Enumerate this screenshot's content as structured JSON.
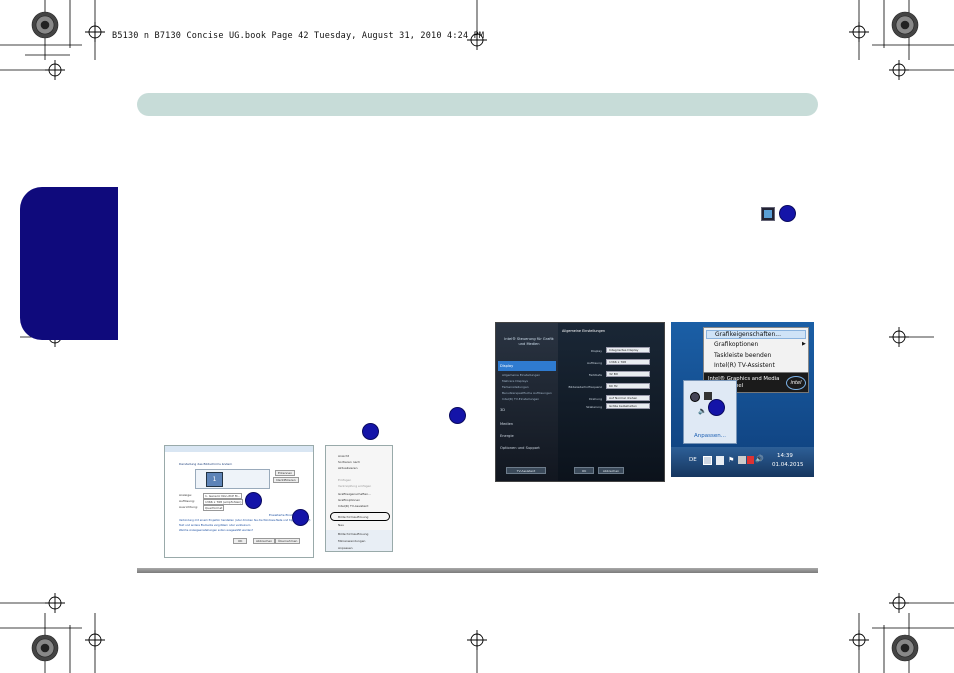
{
  "page_header": {
    "file_info": "B5130 n B7130 Concise UG.book  Page 42  Tuesday, August 31, 2010  4:24 PM"
  },
  "colors": {
    "header_band": "#c7dcd8",
    "side_tab": "#0f0a7c",
    "callout": "#1414a8"
  },
  "dark_panel": {
    "title": "Intel® Steuerung für Grafik und Medien",
    "nav": [
      "Display",
      "3D",
      "Medien",
      "Energie",
      "Optionen und Support"
    ],
    "sub_items": [
      "Allgemeine Einstellungen",
      "Mehrere Displays",
      "Farbeinstellungen",
      "Benutzerspezifische Auflösungen",
      "Intel(R) TV-Einstellungen"
    ],
    "header": "Allgemeine Einstellungen",
    "rows": [
      {
        "label": "Display",
        "value": "Integriertes Display"
      },
      {
        "label": "Auflösung",
        "value": "1366 x 768"
      },
      {
        "label": "Farbtiefe",
        "value": "32 Bit"
      },
      {
        "label": "Bildwiederholfrequenz",
        "value": "60 Hz"
      },
      {
        "label": "Drehung",
        "value": "Auf Normal drehen"
      },
      {
        "label": "Skalierung",
        "value": "Größe beibehalten"
      }
    ],
    "buttons": {
      "tv": "TV-Assistent",
      "ok": "OK",
      "cancel": "Abbrechen"
    }
  },
  "tray_menu": {
    "items": [
      "Grafikeigenschaften...",
      "Grafikoptionen",
      "Taskleiste beenden",
      "Intel(R) TV-Assistent"
    ],
    "banner": "Intel® Graphics and Media Control Panel",
    "intel_logo": "intel",
    "customize": "Anpassen...",
    "lang": "DE",
    "time": "14:39",
    "date": "01.04.2015"
  },
  "win_shot": {
    "heading": "Darstellung des Bildschirms ändern",
    "detect": "Erkennen",
    "identify": "Identifizieren",
    "fields": [
      {
        "label": "Anzeige:",
        "value": "1. Generic Non-PnP M..."
      },
      {
        "label": "Auflösung:",
        "value": "1366 x 768 (empfohlen)"
      },
      {
        "label": "Ausrichtung:",
        "value": "Querformat"
      }
    ],
    "advanced": "Erweiterte Einstellungen",
    "links": [
      "Verbindung mit einem Projektor herstellen (oder drücken Sie die Windows-Taste und tippen Sie auf P)",
      "Text und andere Elemente vergrößern oder verkleinern",
      "Welche Anzeigeeinstellungen sollen ausgewählt werden?"
    ],
    "buttons": [
      "OK",
      "Abbrechen",
      "Übernehmen"
    ]
  },
  "ctx_menu": {
    "items": [
      "Ansicht",
      "Sortieren nach",
      "Aktualisieren",
      "Einfügen",
      "Verknüpfung einfügen",
      "Grafikeigenschaften...",
      "Grafikoptionen",
      "Intel(R) TV-Assistent",
      "Bildschirmauflösung",
      "Minianwendungen",
      "Anpassen",
      "Neu"
    ],
    "footer_items": [
      "Bildschirmauflösung",
      "Minianwendungen",
      "Anpassen"
    ]
  },
  "callouts": [
    "1",
    "2",
    "3",
    "4"
  ]
}
